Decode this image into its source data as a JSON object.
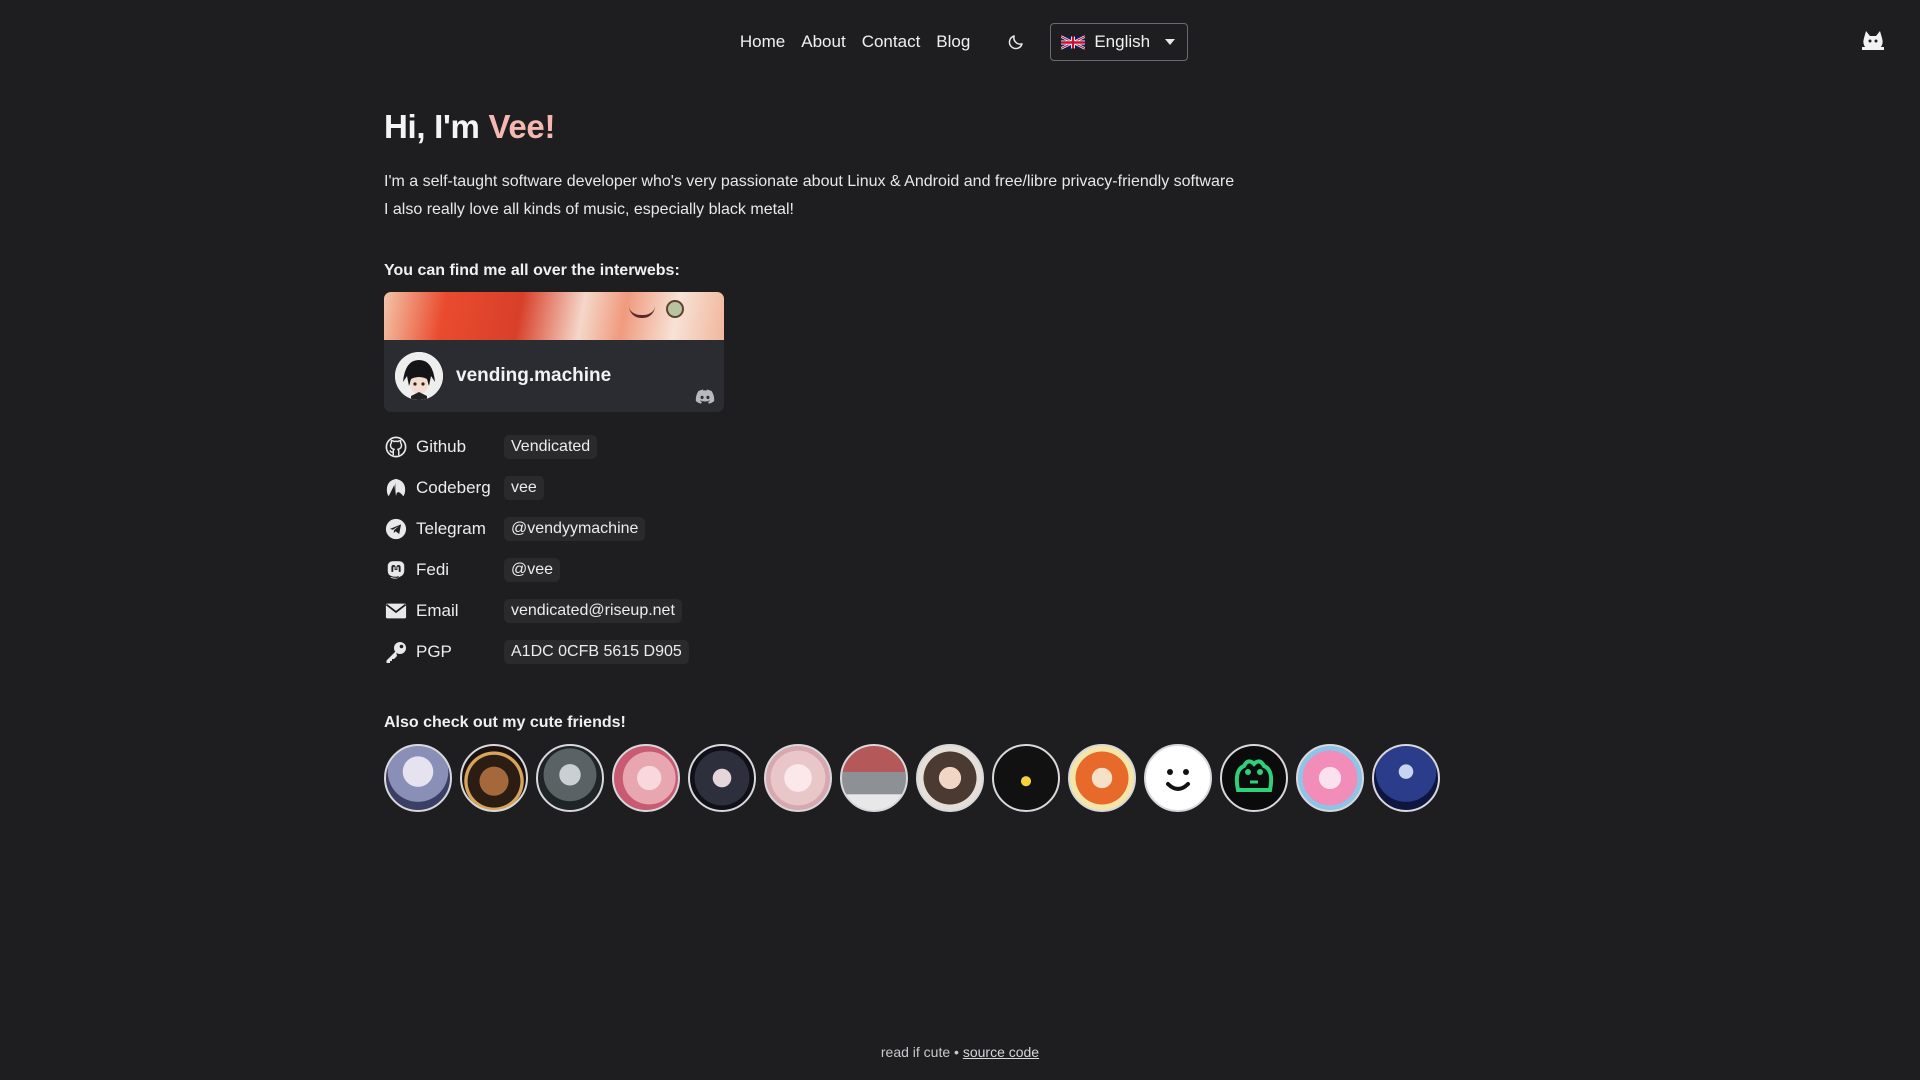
{
  "nav": {
    "links": [
      "Home",
      "About",
      "Contact",
      "Blog"
    ],
    "language": "English"
  },
  "hero": {
    "greeting": "Hi, I'm ",
    "name": "Vee!",
    "bio_line1": "I'm a self-taught software developer who's very passionate about Linux & Android and free/libre privacy-friendly software",
    "bio_line2": "I also really love all kinds of music, especially black metal!"
  },
  "socials": {
    "title": "You can find me all over the interwebs:",
    "discord": {
      "username": "vending.machine"
    },
    "links": [
      {
        "label": "Github",
        "value": "Vendicated",
        "icon": "github-icon"
      },
      {
        "label": "Codeberg",
        "value": "vee",
        "icon": "codeberg-icon"
      },
      {
        "label": "Telegram",
        "value": "@vendyymachine",
        "icon": "telegram-icon"
      },
      {
        "label": "Fedi",
        "value": "@vee",
        "icon": "mastodon-icon"
      },
      {
        "label": "Email",
        "value": "vendicated@riseup.net",
        "icon": "email-icon"
      },
      {
        "label": "PGP",
        "value": "A1DC 0CFB 5615 D905",
        "icon": "key-icon"
      }
    ]
  },
  "friends": {
    "title": "Also check out my cute friends!",
    "avatar_colors": [
      "#8a8fb8",
      "#6b4a2e",
      "#5a6266",
      "#e7a6b0",
      "#2d2f3d",
      "#e9c6c8",
      "#b4585a",
      "#4a3a32",
      "#111111",
      "#e86a2a",
      "#ffffff",
      "#0b0b0b",
      "#f28cb8",
      "#2a3c8a"
    ]
  },
  "footer": {
    "text": "read if cute",
    "link": "source code"
  }
}
